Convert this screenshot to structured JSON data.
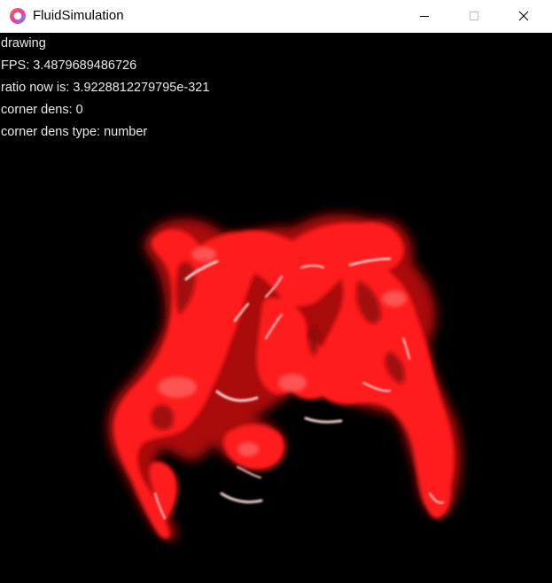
{
  "window": {
    "title": "FluidSimulation",
    "app_icon": "circle-logo-icon",
    "controls": {
      "minimize_icon": "minimize-icon",
      "maximize_icon": "maximize-icon",
      "close_icon": "close-icon"
    }
  },
  "canvas": {
    "background": "#000000",
    "fluid_color": "#ff2020",
    "overlay": {
      "line1": "drawing",
      "line2": "FPS: 3.4879689486726",
      "line3": "ratio now is: 3.9228812279795e-321",
      "line4": "corner dens: 0",
      "line5": "corner dens type: number"
    }
  }
}
